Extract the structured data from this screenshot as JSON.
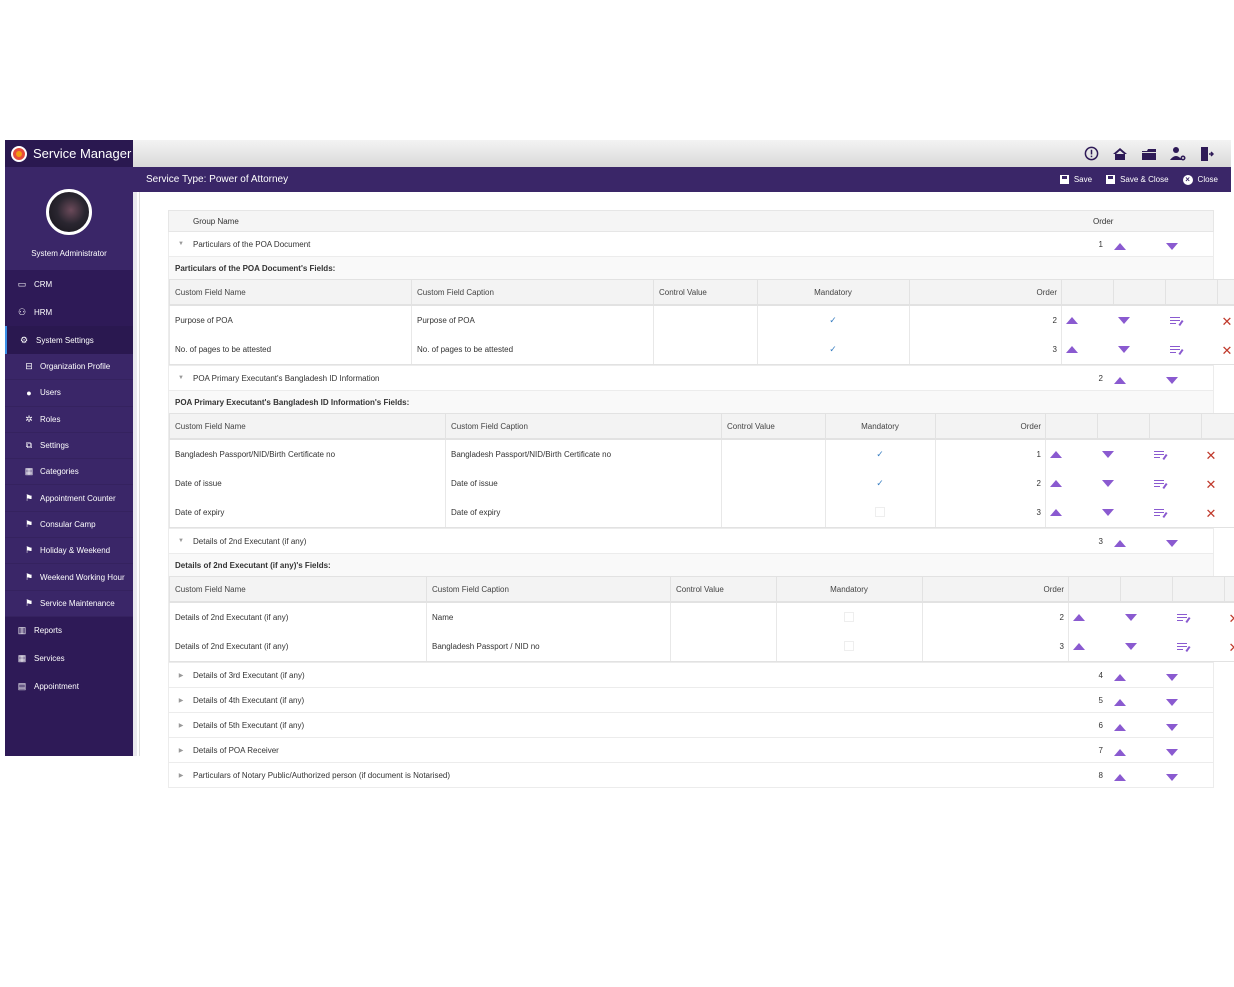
{
  "app": {
    "title": "Service Manager"
  },
  "user": {
    "name": "System Administrator"
  },
  "sidebar": {
    "items": [
      {
        "label": "CRM",
        "icon": "id-card-icon"
      },
      {
        "label": "HRM",
        "icon": "people-icon"
      },
      {
        "label": "System Settings",
        "icon": "gear-icon",
        "active": true
      }
    ],
    "sub_items": [
      {
        "label": "Organization Profile",
        "icon": "briefcase-icon"
      },
      {
        "label": "Users",
        "icon": "user-icon"
      },
      {
        "label": "Roles",
        "icon": "roles-icon"
      },
      {
        "label": "Settings",
        "icon": "settings-doc-icon"
      },
      {
        "label": "Categories",
        "icon": "categories-icon"
      },
      {
        "label": "Appointment Counter",
        "icon": "presenter-icon"
      },
      {
        "label": "Consular Camp",
        "icon": "presenter-icon"
      },
      {
        "label": "Holiday & Weekend",
        "icon": "presenter-icon"
      },
      {
        "label": "Weekend Working Hour",
        "icon": "presenter-icon"
      },
      {
        "label": "Service Maintenance",
        "icon": "presenter-icon"
      }
    ],
    "bottom_items": [
      {
        "label": "Reports",
        "icon": "chart-icon"
      },
      {
        "label": "Services",
        "icon": "grid-icon"
      },
      {
        "label": "Appointment",
        "icon": "calendar-icon"
      }
    ]
  },
  "topbar": {
    "icons": [
      "alert-icon",
      "home-icon",
      "folder-icon",
      "user-settings-icon",
      "logout-icon"
    ]
  },
  "subbar": {
    "title": "Service Type: Power of Attorney",
    "save": "Save",
    "save_close": "Save & Close",
    "close": "Close"
  },
  "grid": {
    "header": {
      "group_name": "Group Name",
      "order": "Order"
    },
    "field_headers": {
      "name": "Custom Field Name",
      "caption": "Custom Field Caption",
      "control": "Control Value",
      "mandatory": "Mandatory",
      "order": "Order"
    },
    "groups": [
      {
        "name": "Particulars of the POA Document",
        "order": "1",
        "expanded": true,
        "fields_title": "Particulars of the POA Document's Fields:",
        "fields": [
          {
            "name": "Purpose of POA",
            "caption": "Purpose of POA",
            "control": "",
            "mandatory": true,
            "order": "2"
          },
          {
            "name": "No. of pages to be attested",
            "caption": "No. of pages to be attested",
            "control": "",
            "mandatory": true,
            "order": "3"
          }
        ]
      },
      {
        "name": "POA Primary Executant's Bangladesh ID Information",
        "order": "2",
        "expanded": true,
        "fields_title": "POA Primary Executant's Bangladesh ID Information's Fields:",
        "fields": [
          {
            "name": "Bangladesh Passport/NID/Birth Certificate no",
            "caption": "Bangladesh Passport/NID/Birth Certificate no",
            "control": "",
            "mandatory": true,
            "order": "1"
          },
          {
            "name": "Date of issue",
            "caption": "Date of issue",
            "control": "",
            "mandatory": true,
            "order": "2"
          },
          {
            "name": "Date of expiry",
            "caption": "Date of expiry",
            "control": "",
            "mandatory": false,
            "order": "3"
          }
        ]
      },
      {
        "name": "Details of 2nd Executant (if any)",
        "order": "3",
        "expanded": true,
        "fields_title": "Details of 2nd Executant (if any)'s Fields:",
        "fields": [
          {
            "name": "Details of 2nd Executant (if any)",
            "caption": "Name",
            "control": "",
            "mandatory": false,
            "order": "2"
          },
          {
            "name": "Details of 2nd Executant (if any)",
            "caption": "Bangladesh Passport / NID no",
            "control": "",
            "mandatory": false,
            "order": "3"
          }
        ]
      },
      {
        "name": "Details of 3rd Executant (if any)",
        "order": "4",
        "expanded": false
      },
      {
        "name": "Details of 4th Executant (if any)",
        "order": "5",
        "expanded": false
      },
      {
        "name": "Details of 5th Executant (if any)",
        "order": "6",
        "expanded": false
      },
      {
        "name": "Details of POA Receiver",
        "order": "7",
        "expanded": false
      },
      {
        "name": "Particulars of Notary Public/Authorized person (if document is Notarised)",
        "order": "8",
        "expanded": false
      }
    ]
  },
  "colors": {
    "brand": "#2e1a57",
    "accent": "#8a5ad0",
    "delete": "#c0392b",
    "check": "#3a7fc2"
  }
}
